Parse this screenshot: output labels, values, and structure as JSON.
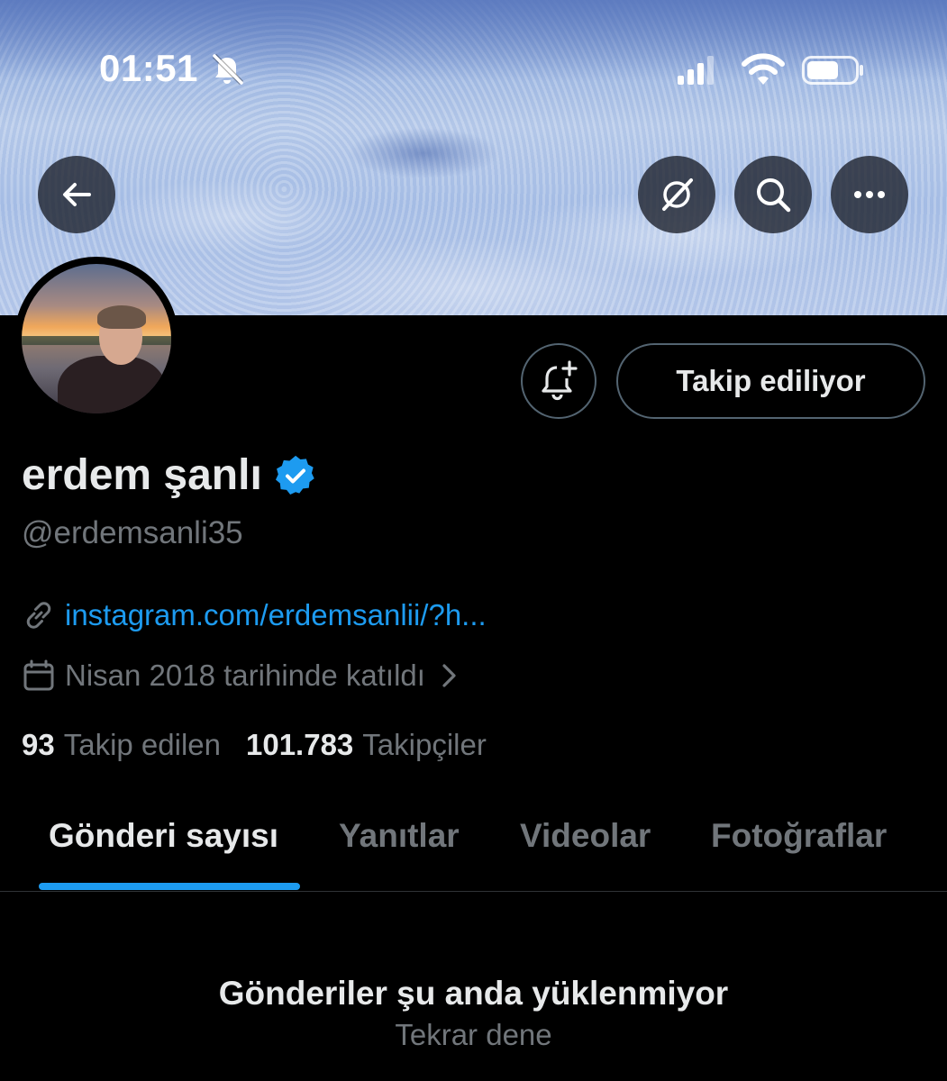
{
  "status_bar": {
    "time": "01:51",
    "icons": [
      "bell-slash-icon",
      "signal-icon",
      "wifi-icon",
      "battery-icon"
    ]
  },
  "header": {
    "back_icon": "arrow-left-icon",
    "actions": [
      "grok-icon",
      "search-icon",
      "more-icon"
    ]
  },
  "profile": {
    "name": "erdem şanlı",
    "verified": true,
    "handle": "@erdemsanli35",
    "link_text": "instagram.com/erdemsanlii/?h...",
    "joined_text": "Nisan 2018 tarihinde katıldı",
    "following_count": "93",
    "following_label": "Takip edilen",
    "followers_count": "101.783",
    "followers_label": "Takipçiler"
  },
  "buttons": {
    "notify_icon": "bell-plus-icon",
    "follow_label": "Takip ediliyor"
  },
  "tabs": [
    {
      "label": "Gönderi sayısı",
      "active": true
    },
    {
      "label": "Yanıtlar",
      "active": false
    },
    {
      "label": "Videolar",
      "active": false
    },
    {
      "label": "Fotoğraflar",
      "active": false
    }
  ],
  "empty_state": {
    "title": "Gönderiler şu anda yüklenmiyor",
    "retry": "Tekrar dene"
  },
  "colors": {
    "background": "#000000",
    "accent": "#1d9bf0",
    "text_primary": "#e7e9ea",
    "text_secondary": "#71767b",
    "border": "#536471"
  }
}
